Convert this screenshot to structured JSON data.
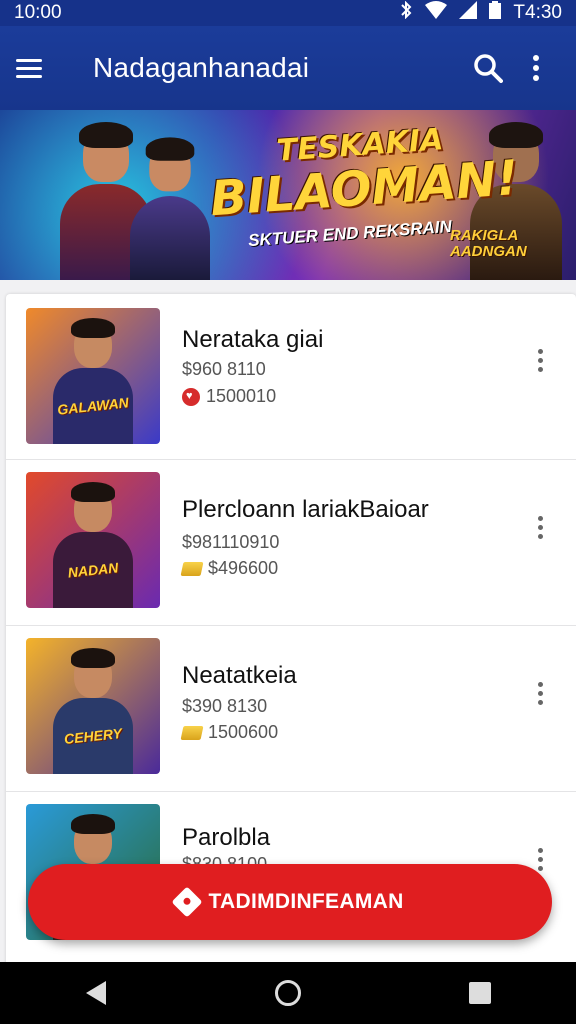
{
  "status": {
    "time_left": "10:00",
    "time_right": "T4:30"
  },
  "app_bar": {
    "title": "Nadaganhanadai"
  },
  "banner": {
    "title_line1": "TESKAKIA",
    "title_line2": "BILAOMAN!",
    "subtitle": "SKTUER END REKSRAIN",
    "badge": "RAKIGLA AADNGAN"
  },
  "items": [
    {
      "title": "Nerataka giai",
      "price": "$960 8110",
      "sub": "1500010",
      "sub_icon": "heart-badge-icon",
      "art_text": "GALAWAN",
      "colors": [
        "#f08a2a",
        "#3a3ac8"
      ]
    },
    {
      "title": "Plercloann lariakBaioar",
      "price": "$981110910",
      "sub": "$496600",
      "sub_icon": "gold-bar-icon",
      "art_text": "NADAN",
      "colors": [
        "#e24a2a",
        "#6a2ab0"
      ]
    },
    {
      "title": "Neatatkeia",
      "price": "$390 8130",
      "sub": "1500600",
      "sub_icon": "gold-bar-icon",
      "art_text": "CEHERY",
      "colors": [
        "#f4b32a",
        "#4a2a9a"
      ]
    },
    {
      "title": "Parolbla",
      "price": "$830 8100",
      "sub": "",
      "sub_icon": "",
      "art_text": "",
      "colors": [
        "#2a9ad8",
        "#2a6a3a"
      ]
    }
  ],
  "cta": {
    "label": "TADIMDINFEAMAN"
  },
  "accent": "#e01e20",
  "brand": "#17358c"
}
